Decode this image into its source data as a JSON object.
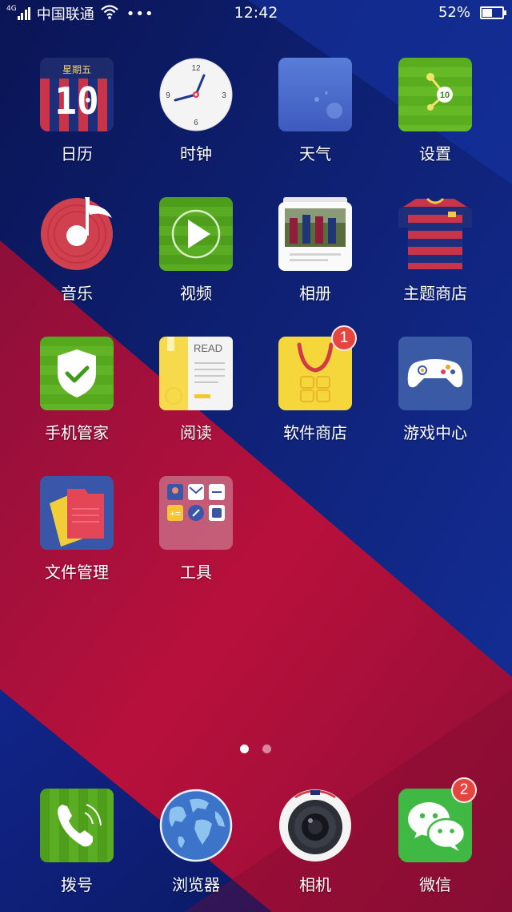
{
  "status_bar": {
    "network_type": "4G",
    "carrier": "中国联通",
    "more": "•••",
    "time": "12:42",
    "battery_percent": "52%",
    "battery_level": 0.52
  },
  "apps": [
    {
      "id": "calendar",
      "label": "日历",
      "icon": "calendar-icon",
      "weekday": "星期五",
      "day": "10"
    },
    {
      "id": "clock",
      "label": "时钟",
      "icon": "clock-icon",
      "dial": [
        "12",
        "3",
        "6",
        "9"
      ]
    },
    {
      "id": "weather",
      "label": "天气",
      "icon": "weather-icon"
    },
    {
      "id": "settings",
      "label": "设置",
      "icon": "settings-icon",
      "number": "10"
    },
    {
      "id": "music",
      "label": "音乐",
      "icon": "music-icon"
    },
    {
      "id": "video",
      "label": "视频",
      "icon": "video-icon"
    },
    {
      "id": "gallery",
      "label": "相册",
      "icon": "gallery-icon"
    },
    {
      "id": "theme-store",
      "label": "主题商店",
      "icon": "theme-store-icon"
    },
    {
      "id": "phone-manager",
      "label": "手机管家",
      "icon": "phone-manager-icon"
    },
    {
      "id": "reader",
      "label": "阅读",
      "icon": "reader-icon",
      "caption": "READ"
    },
    {
      "id": "app-store",
      "label": "软件商店",
      "icon": "app-store-icon",
      "badge": "1"
    },
    {
      "id": "game-center",
      "label": "游戏中心",
      "icon": "game-center-icon"
    },
    {
      "id": "file-manager",
      "label": "文件管理",
      "icon": "file-manager-icon"
    },
    {
      "id": "tools",
      "label": "工具",
      "icon": "tools-folder-icon"
    }
  ],
  "page_indicator": {
    "pages": 2,
    "current": 1
  },
  "dock": [
    {
      "id": "dialer",
      "label": "拨号",
      "icon": "phone-icon"
    },
    {
      "id": "browser",
      "label": "浏览器",
      "icon": "browser-globe-icon"
    },
    {
      "id": "camera",
      "label": "相机",
      "icon": "camera-icon"
    },
    {
      "id": "wechat",
      "label": "微信",
      "icon": "wechat-icon",
      "badge": "2"
    }
  ],
  "colors": {
    "wallpaper_blue": "#0d1f78",
    "wallpaper_red": "#b3103a",
    "badge_red": "#e5453f"
  }
}
